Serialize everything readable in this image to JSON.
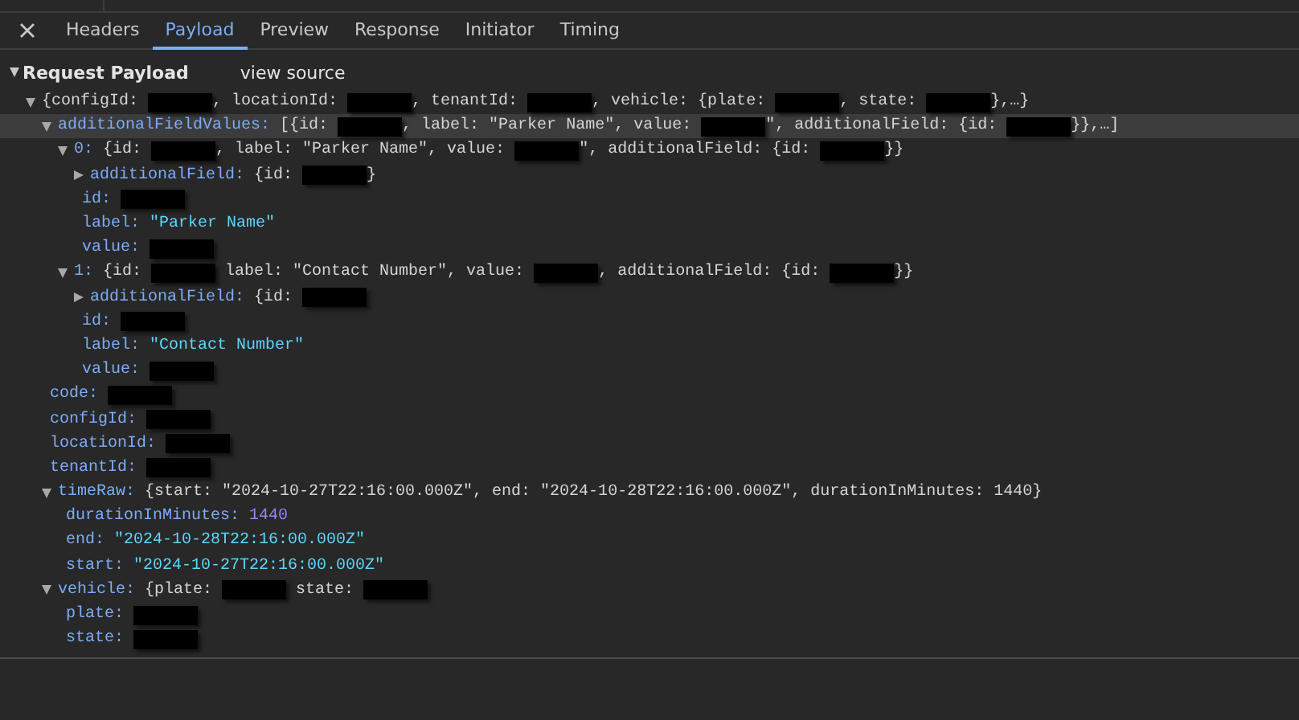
{
  "tabs": [
    {
      "label": "Headers",
      "selected": false
    },
    {
      "label": "Payload",
      "selected": true
    },
    {
      "label": "Preview",
      "selected": false
    },
    {
      "label": "Response",
      "selected": false
    },
    {
      "label": "Initiator",
      "selected": false
    },
    {
      "label": "Timing",
      "selected": false
    }
  ],
  "section": {
    "title": "Request Payload",
    "expanded": true,
    "link": "view source"
  },
  "tree": [
    {
      "expanded": true,
      "selected": false,
      "value": [
        {
          "kind": "text",
          "text": "{configId: "
        },
        {
          "kind": "redacted"
        },
        {
          "kind": "text",
          "text": ", locationId: "
        },
        {
          "kind": "redacted"
        },
        {
          "kind": "text",
          "text": ", tenantId: "
        },
        {
          "kind": "redacted"
        },
        {
          "kind": "text",
          "text": ", vehicle: {plate: "
        },
        {
          "kind": "redacted"
        },
        {
          "kind": "text",
          "text": ", state: "
        },
        {
          "kind": "redacted"
        },
        {
          "kind": "text",
          "text": "},…}"
        }
      ],
      "children": [
        {
          "key": "additionalFieldValues:",
          "expanded": true,
          "selected": true,
          "value": [
            {
              "kind": "text",
              "text": "[{id: "
            },
            {
              "kind": "redacted"
            },
            {
              "kind": "text",
              "text": ", label: \"Parker Name\", value: "
            },
            {
              "kind": "redacted"
            },
            {
              "kind": "text",
              "text": "\", additionalField: {id: "
            },
            {
              "kind": "redacted"
            },
            {
              "kind": "text",
              "text": "}},…]"
            }
          ],
          "children": [
            {
              "key": "0:",
              "expanded": true,
              "selected": false,
              "value": [
                {
                  "kind": "text",
                  "text": "{id: "
                },
                {
                  "kind": "redacted"
                },
                {
                  "kind": "text",
                  "text": ", label: \"Parker Name\", value: "
                },
                {
                  "kind": "redacted"
                },
                {
                  "kind": "text",
                  "text": "\", additionalField: {id: "
                },
                {
                  "kind": "redacted"
                },
                {
                  "kind": "text",
                  "text": "}}"
                }
              ],
              "children": [
                {
                  "key": "additionalField:",
                  "expanded": false,
                  "selected": false,
                  "value": [
                    {
                      "kind": "text",
                      "text": "{id: "
                    },
                    {
                      "kind": "redacted"
                    },
                    {
                      "kind": "text",
                      "text": "}"
                    }
                  ]
                },
                {
                  "key": "id:",
                  "selected": false,
                  "value": [
                    {
                      "kind": "redacted"
                    }
                  ]
                },
                {
                  "key": "label:",
                  "selected": false,
                  "value": [
                    {
                      "kind": "string",
                      "text": "\"Parker Name\""
                    }
                  ]
                },
                {
                  "key": "value:",
                  "selected": false,
                  "value": [
                    {
                      "kind": "redacted"
                    }
                  ]
                }
              ]
            },
            {
              "key": "1:",
              "expanded": true,
              "selected": false,
              "value": [
                {
                  "kind": "text",
                  "text": "{id: "
                },
                {
                  "kind": "redacted"
                },
                {
                  "kind": "text",
                  "text": " label: \"Contact Number\", value: "
                },
                {
                  "kind": "redacted"
                },
                {
                  "kind": "text",
                  "text": ", additionalField: {id: "
                },
                {
                  "kind": "redacted"
                },
                {
                  "kind": "text",
                  "text": "}}"
                }
              ],
              "children": [
                {
                  "key": "additionalField:",
                  "expanded": false,
                  "selected": false,
                  "value": [
                    {
                      "kind": "text",
                      "text": "{id: "
                    },
                    {
                      "kind": "redacted"
                    }
                  ]
                },
                {
                  "key": "id:",
                  "selected": false,
                  "value": [
                    {
                      "kind": "redacted"
                    }
                  ]
                },
                {
                  "key": "label:",
                  "selected": false,
                  "value": [
                    {
                      "kind": "string",
                      "text": "\"Contact Number\""
                    }
                  ]
                },
                {
                  "key": "value:",
                  "selected": false,
                  "value": [
                    {
                      "kind": "redacted"
                    }
                  ]
                }
              ]
            }
          ]
        },
        {
          "key": "code:",
          "selected": false,
          "value": [
            {
              "kind": "redacted"
            }
          ]
        },
        {
          "key": "configId:",
          "selected": false,
          "value": [
            {
              "kind": "redacted"
            }
          ]
        },
        {
          "key": "locationId:",
          "selected": false,
          "value": [
            {
              "kind": "redacted"
            }
          ]
        },
        {
          "key": "tenantId:",
          "selected": false,
          "value": [
            {
              "kind": "redacted"
            }
          ]
        },
        {
          "key": "timeRaw:",
          "expanded": true,
          "selected": false,
          "value": [
            {
              "kind": "text",
              "text": "{start: \"2024-10-27T22:16:00.000Z\", end: \"2024-10-28T22:16:00.000Z\", durationInMinutes: 1440}"
            }
          ],
          "children": [
            {
              "key": "durationInMinutes:",
              "selected": false,
              "value": [
                {
                  "kind": "number",
                  "text": "1440"
                }
              ]
            },
            {
              "key": "end:",
              "selected": false,
              "value": [
                {
                  "kind": "string",
                  "text": "\"2024-10-28T22:16:00.000Z\""
                }
              ]
            },
            {
              "key": "start:",
              "selected": false,
              "value": [
                {
                  "kind": "string",
                  "text": "\"2024-10-27T22:16:00.000Z\""
                }
              ]
            }
          ]
        },
        {
          "key": "vehicle:",
          "expanded": true,
          "selected": false,
          "value": [
            {
              "kind": "text",
              "text": "{plate: "
            },
            {
              "kind": "redacted"
            },
            {
              "kind": "text",
              "text": " state: "
            },
            {
              "kind": "redacted"
            }
          ],
          "children": [
            {
              "key": "plate:",
              "selected": false,
              "value": [
                {
                  "kind": "redacted"
                }
              ]
            },
            {
              "key": "state:",
              "selected": false,
              "value": [
                {
                  "kind": "redacted"
                }
              ]
            }
          ]
        }
      ]
    }
  ]
}
